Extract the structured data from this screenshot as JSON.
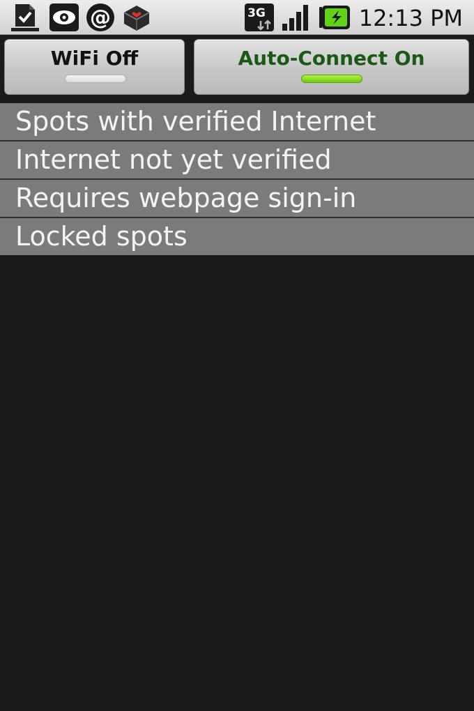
{
  "status_bar": {
    "time": "12:13 PM",
    "network_type": "3G",
    "icons": [
      "download-done-icon",
      "eye-icon",
      "at-sign-icon",
      "inbox-heart-icon",
      "3g-data-icon",
      "signal-strength-icon",
      "battery-charging-icon"
    ]
  },
  "toggles": {
    "wifi_label": "WiFi Off",
    "auto_connect_label": "Auto-Connect On"
  },
  "categories": [
    {
      "label": "Spots with verified Internet"
    },
    {
      "label": "Internet not yet verified"
    },
    {
      "label": "Requires webpage sign-in"
    },
    {
      "label": "Locked spots"
    }
  ],
  "colors": {
    "auto_connect_text": "#1a5a14",
    "indicator_on": "#7ed321",
    "list_item_bg": "#7b7b7b",
    "background": "#1b1b1b"
  }
}
